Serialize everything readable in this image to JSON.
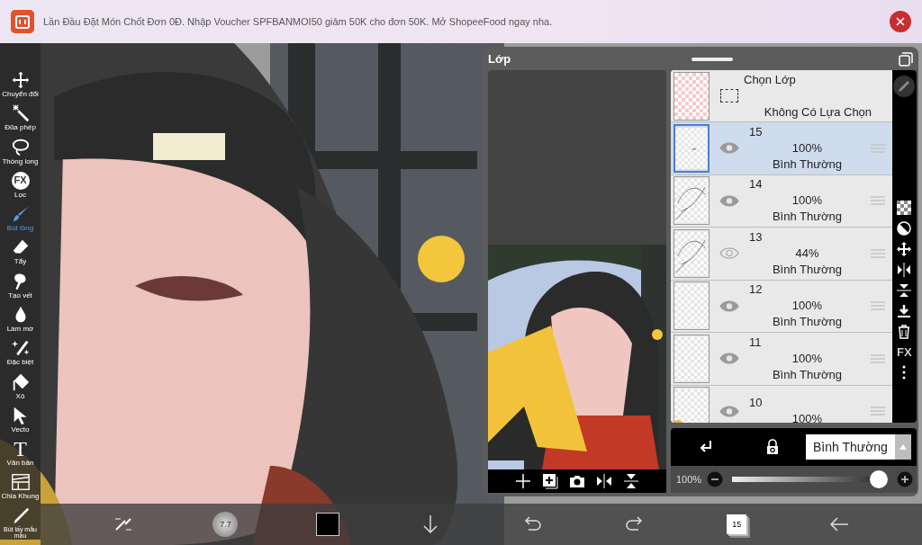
{
  "ad": {
    "text": "Lần Đầu Đặt Món Chốt Đơn 0Đ. Nhập Voucher SPFBANMOI50 giảm 50K cho đơn 50K. Mở ShopeeFood ngay nha."
  },
  "tools": [
    {
      "label": "Chuyển đổi",
      "kind": "move",
      "selected": false
    },
    {
      "label": "Đũa phép",
      "kind": "wand",
      "selected": false
    },
    {
      "label": "Thòng long",
      "kind": "lasso",
      "selected": false
    },
    {
      "label": "Lọc",
      "kind": "filter",
      "icon_text": "FX",
      "selected": false
    },
    {
      "label": "Bút lông",
      "kind": "brush",
      "selected": true
    },
    {
      "label": "Tẩy",
      "kind": "eraser",
      "selected": false
    },
    {
      "label": "Tạo vết",
      "kind": "smudge",
      "selected": false
    },
    {
      "label": "Làm mờ",
      "kind": "blur",
      "selected": false
    },
    {
      "label": "Đặc biệt",
      "kind": "special",
      "selected": false
    },
    {
      "label": "Xô",
      "kind": "bucket",
      "selected": false
    },
    {
      "label": "Vecto",
      "kind": "vector",
      "selected": false
    },
    {
      "label": "Văn bản",
      "kind": "text",
      "icon_text": "T",
      "selected": false
    },
    {
      "label": "Chia Khung",
      "kind": "frame",
      "selected": false
    },
    {
      "label": "Bút lấy mẫu màu",
      "kind": "picker",
      "selected": false
    }
  ],
  "layers_panel": {
    "title": "Lớp",
    "selection_layer": {
      "title": "Chọn Lớp",
      "status": "Không Có Lựa Chọn"
    },
    "layers": [
      {
        "name": "15",
        "opacity": "100%",
        "blend": "Bình Thường",
        "visible": true,
        "selected": true,
        "kind": "mark"
      },
      {
        "name": "14",
        "opacity": "100%",
        "blend": "Bình Thường",
        "visible": true,
        "selected": false,
        "kind": "sketch"
      },
      {
        "name": "13",
        "opacity": "44%",
        "blend": "Bình Thường",
        "visible": false,
        "selected": false,
        "kind": "sketch"
      },
      {
        "name": "12",
        "opacity": "100%",
        "blend": "Bình Thường",
        "visible": true,
        "selected": false,
        "kind": "blank"
      },
      {
        "name": "11",
        "opacity": "100%",
        "blend": "Bình Thường",
        "visible": true,
        "selected": false,
        "kind": "blank"
      },
      {
        "name": "10",
        "opacity": "100%",
        "visible": true,
        "selected": false,
        "kind": "flower"
      }
    ],
    "fx_label": "FX",
    "blend_mode": "Bình Thường",
    "opacity": {
      "reading": "100%",
      "level": 1
    }
  },
  "bottom_bar": {
    "brush_size": "7.7",
    "layer_count": "15"
  }
}
